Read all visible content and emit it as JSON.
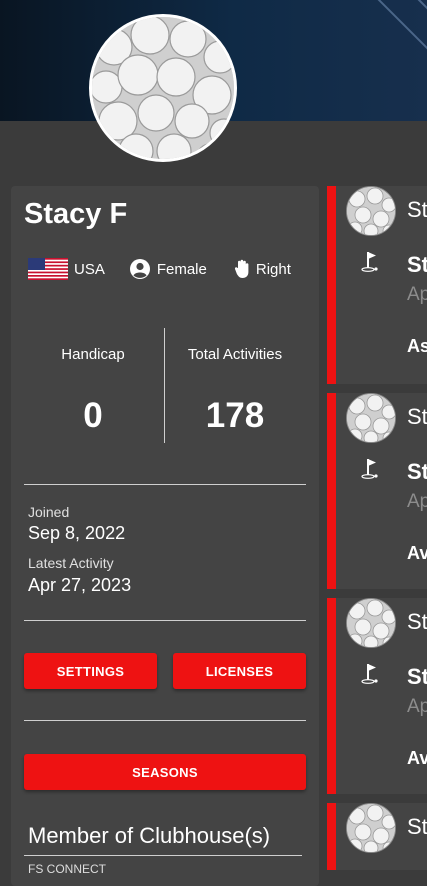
{
  "profile": {
    "name": "Stacy F",
    "country": "USA",
    "gender": "Female",
    "hand": "Right"
  },
  "stats": {
    "handicap_label": "Handicap",
    "handicap_value": "0",
    "activities_label": "Total Activities",
    "activities_value": "178"
  },
  "dates": {
    "joined_label": "Joined",
    "joined_value": "Sep 8, 2022",
    "latest_label": "Latest Activity",
    "latest_value": "Apr 27, 2023"
  },
  "buttons": {
    "settings": "SETTINGS",
    "licenses": "LICENSES",
    "seasons": "SEASONS"
  },
  "clubhouse": {
    "title": "Member of Clubhouse(s)",
    "first_item": "FS CONNECT"
  },
  "feed": [
    {
      "name": "St",
      "title": "St",
      "sub": "Ap",
      "meta": "As"
    },
    {
      "name": "St",
      "title": "St",
      "sub": "Ap",
      "meta": "Av"
    },
    {
      "name": "St",
      "title": "St",
      "sub": "Ap",
      "meta": "Av"
    },
    {
      "name": "St"
    }
  ],
  "icons": {
    "flag": "us-flag-icon",
    "gender": "person-circle-icon",
    "hand": "hand-icon",
    "golf": "golf-flag-icon"
  },
  "colors": {
    "accent": "#ee1212",
    "panel": "#444444",
    "background": "#3b3b3b"
  }
}
